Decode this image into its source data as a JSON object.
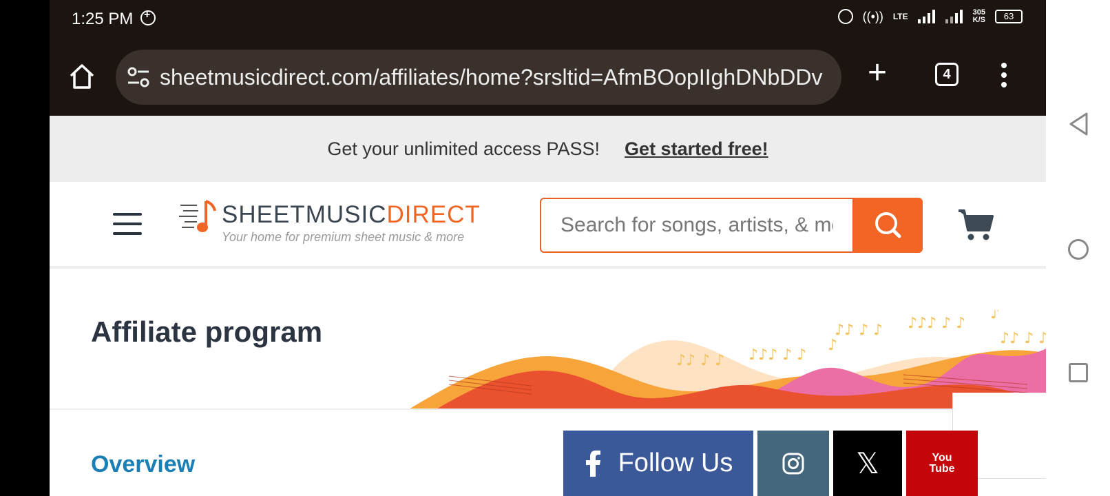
{
  "status_bar": {
    "time": "1:25 PM",
    "network": "LTE",
    "speed_value": "305",
    "speed_unit": "K/S",
    "battery": "63"
  },
  "browser": {
    "url": "sheetmusicdirect.com/affiliates/home?srsltid=AfmBOopIIghDNbDDv",
    "tab_count": "4",
    "new_tab_symbol": "+"
  },
  "promo": {
    "text": "Get your unlimited access PASS!",
    "link": "Get started free!"
  },
  "header": {
    "logo_name_part1": "SHEETMUSIC",
    "logo_name_part2": "DIRECT",
    "logo_tagline": "Your home for premium sheet music & more",
    "search_placeholder": "Search for songs, artists, & mor"
  },
  "hero": {
    "title": "Affiliate program"
  },
  "content": {
    "section_heading": "Overview"
  },
  "social": {
    "follow_label": "Follow Us",
    "x_glyph": "𝕏",
    "youtube_line1": "You",
    "youtube_line2": "Tube"
  },
  "colors": {
    "brand_orange": "#f26524",
    "link_blue": "#1a7fb5",
    "facebook": "#3b5998",
    "instagram": "#45677e",
    "youtube": "#c4060b"
  }
}
